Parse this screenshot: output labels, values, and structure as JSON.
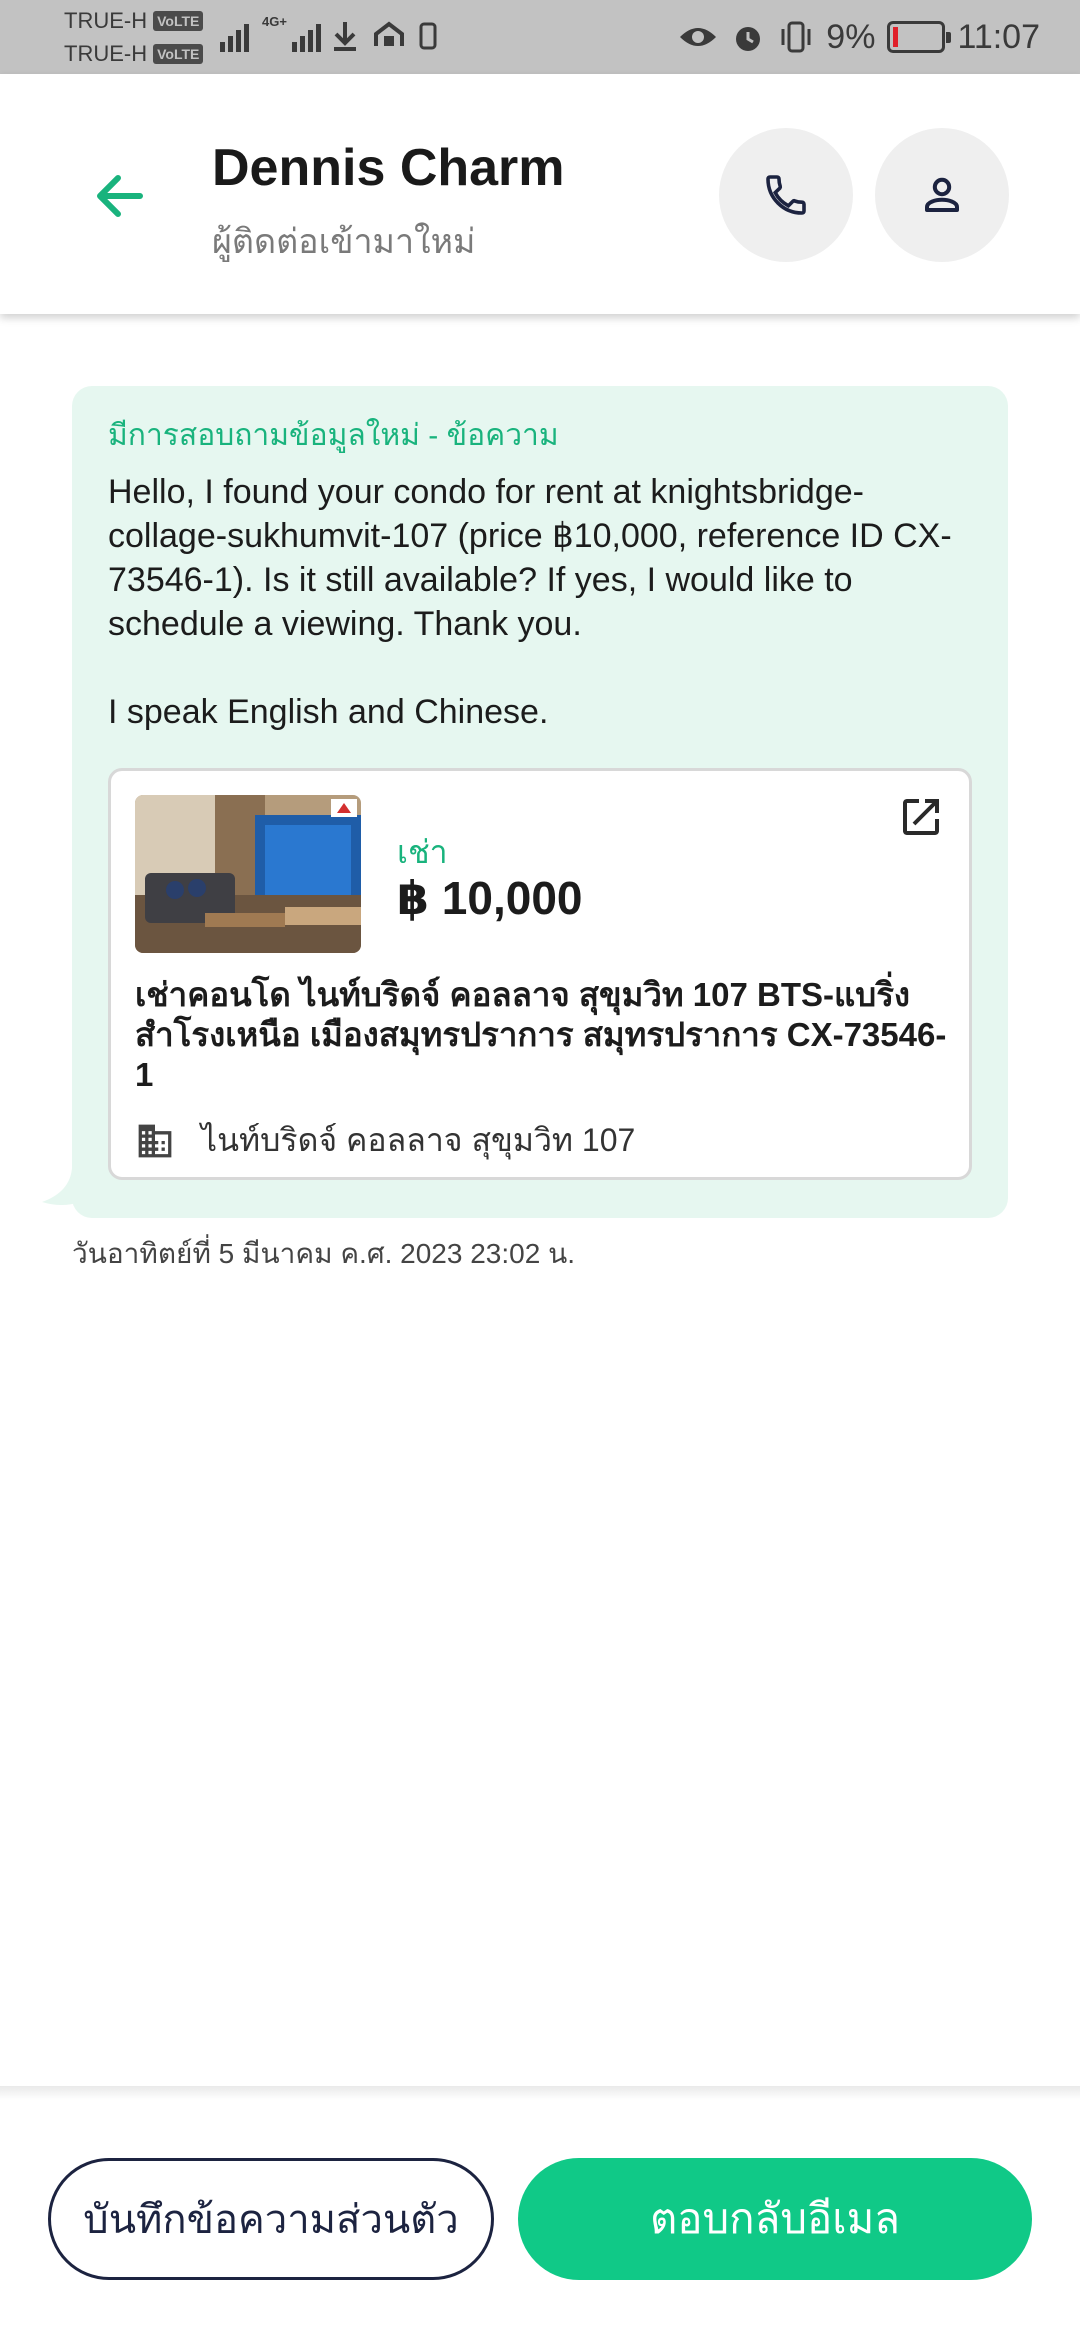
{
  "status_bar": {
    "carrier_1": "TRUE-H",
    "carrier_2": "TRUE-H",
    "volte_badge": "VoLTE",
    "network": "4G+",
    "battery": "9%",
    "time": "11:07"
  },
  "header": {
    "contact_name": "Dennis Charm",
    "contact_status": "ผู้ติดต่อเข้ามาใหม่"
  },
  "message": {
    "title": "มีการสอบถามข้อมูลใหม่ - ข้อความ",
    "body": "Hello, I found your condo for rent at knightsbridge-collage-sukhumvit-107 (price ฿10,000, reference ID CX-73546-1). Is it still available? If yes, I would like to schedule a viewing. Thank you.\n\nI speak English and Chinese.",
    "timestamp": "วันอาทิตย์ที่ 5 มีนาคม ค.ศ. 2023 23:02 น."
  },
  "listing": {
    "type": "เช่า",
    "price": "฿ 10,000",
    "title": "เช่าคอนโด  ไนท์บริดจ์ คอลลาจ สุขุมวิท 107 BTS-แบริ่ง สำโรงเหนือ เมืองสมุทรปราการ สมุทรปราการ CX-73546-1",
    "building": "ไนท์บริดจ์ คอลลาจ สุขุมวิท 107"
  },
  "actions": {
    "private_note": "บันทึกข้อความส่วนตัว",
    "reply_email": "ตอบกลับอีเมล"
  },
  "colors": {
    "accent_green": "#10c987",
    "bubble_bg": "#e6f7f0",
    "dark_navy": "#1c2340"
  }
}
